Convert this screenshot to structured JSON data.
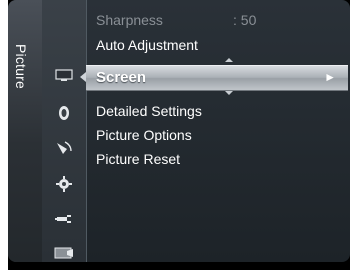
{
  "sidebar": {
    "category_label": "Picture"
  },
  "icons": [
    {
      "name": "picture-icon"
    },
    {
      "name": "sound-icon"
    },
    {
      "name": "channel-icon"
    },
    {
      "name": "setup-icon"
    },
    {
      "name": "input-icon"
    },
    {
      "name": "application-icon"
    }
  ],
  "menu": {
    "sharpness_label": "Sharpness",
    "sharpness_value": ": 50",
    "auto_adjustment_label": "Auto Adjustment",
    "selected_label": "Screen",
    "selected_arrow": "►",
    "detailed_settings_label": "Detailed Settings",
    "picture_options_label": "Picture Options",
    "picture_reset_label": "Picture Reset"
  },
  "colors": {
    "panel_bg": "#2a3138",
    "highlight": "#c0c5ca",
    "dim_text": "#8a9096"
  }
}
